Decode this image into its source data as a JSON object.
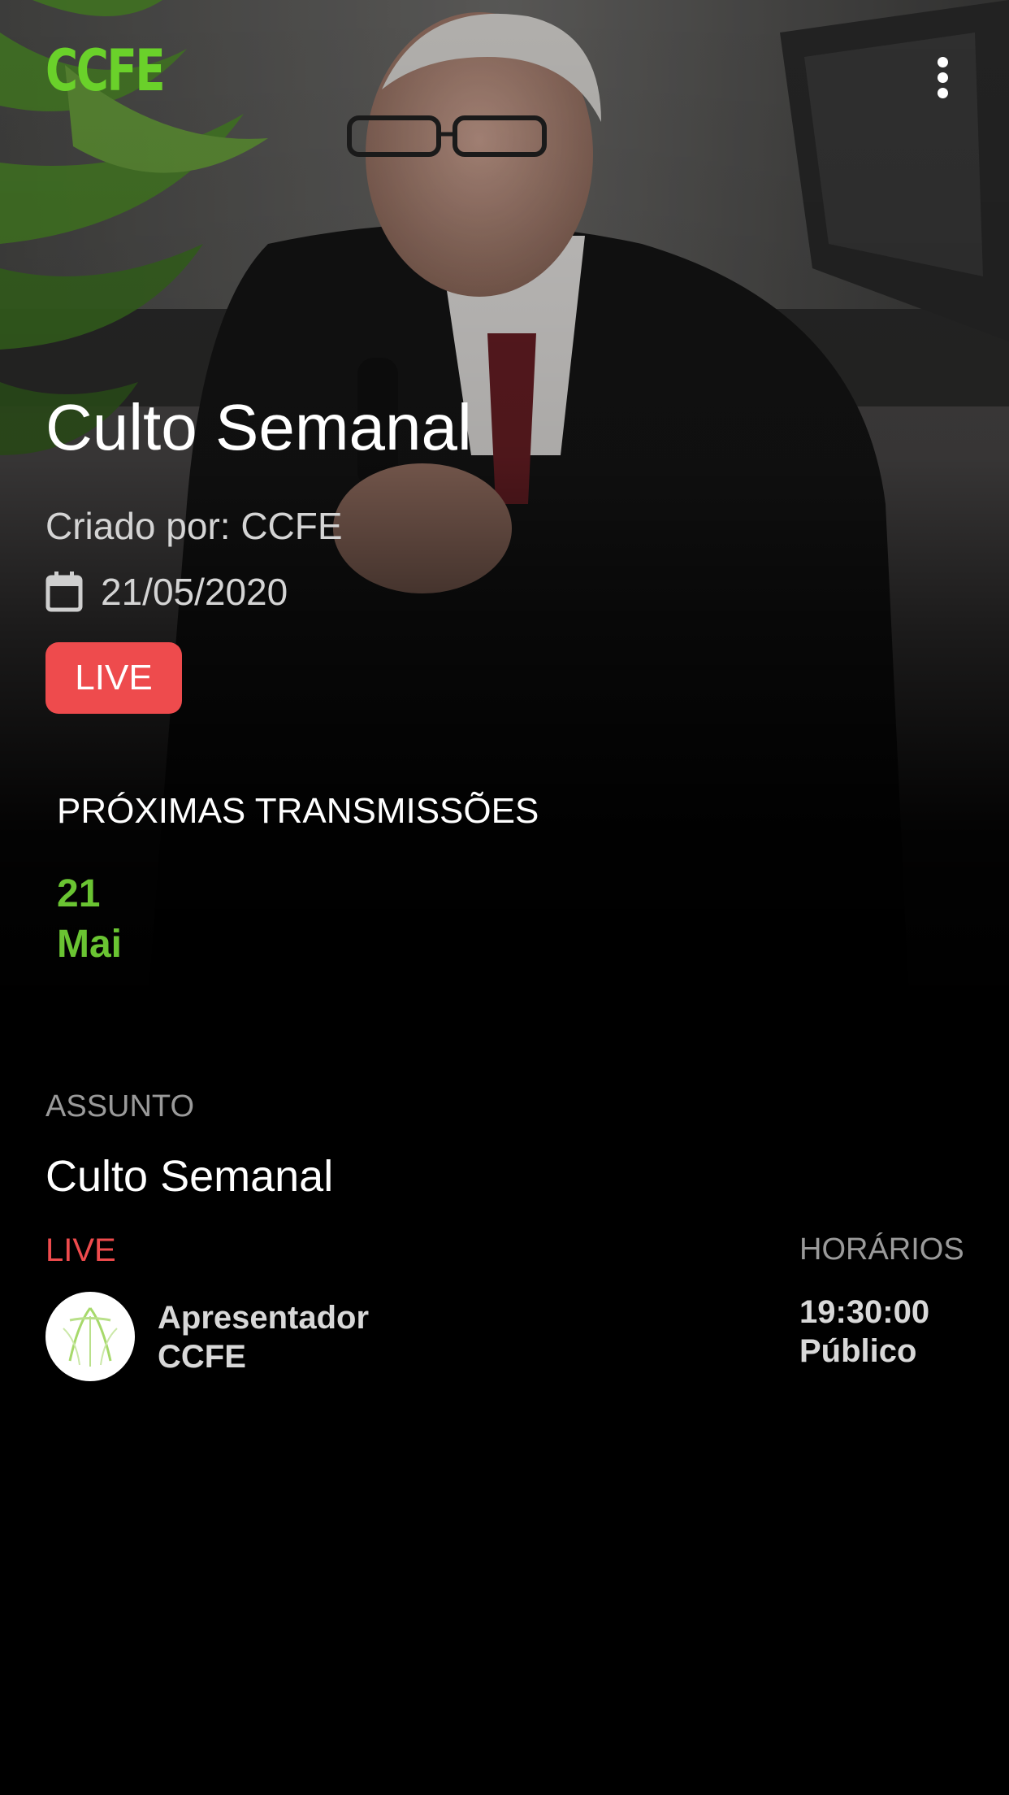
{
  "header": {
    "logo_text": "CCFE",
    "menu_icon": "more-vertical-icon"
  },
  "event": {
    "title": "Culto Semanal",
    "creator": "Criado por: CCFE",
    "date_icon": "calendar-icon",
    "date": "21/05/2020",
    "live_badge": "LIVE"
  },
  "upcoming": {
    "title": "PRÓXIMAS TRANSMISSÕES",
    "day": "21",
    "month": "Mai"
  },
  "details": {
    "subject_label": "ASSUNTO",
    "subject_value": "Culto Semanal",
    "live_label": "LIVE",
    "presenter_role": "Apresentador",
    "presenter_name": "CCFE",
    "hours_label": "HORÁRIOS",
    "hours_time": "19:30:00",
    "hours_audience": "Público"
  },
  "colors": {
    "accent_green": "#6ad12a",
    "live_red": "#ee4b4d",
    "background": "#000000",
    "muted_text": "#9a9a9a"
  }
}
